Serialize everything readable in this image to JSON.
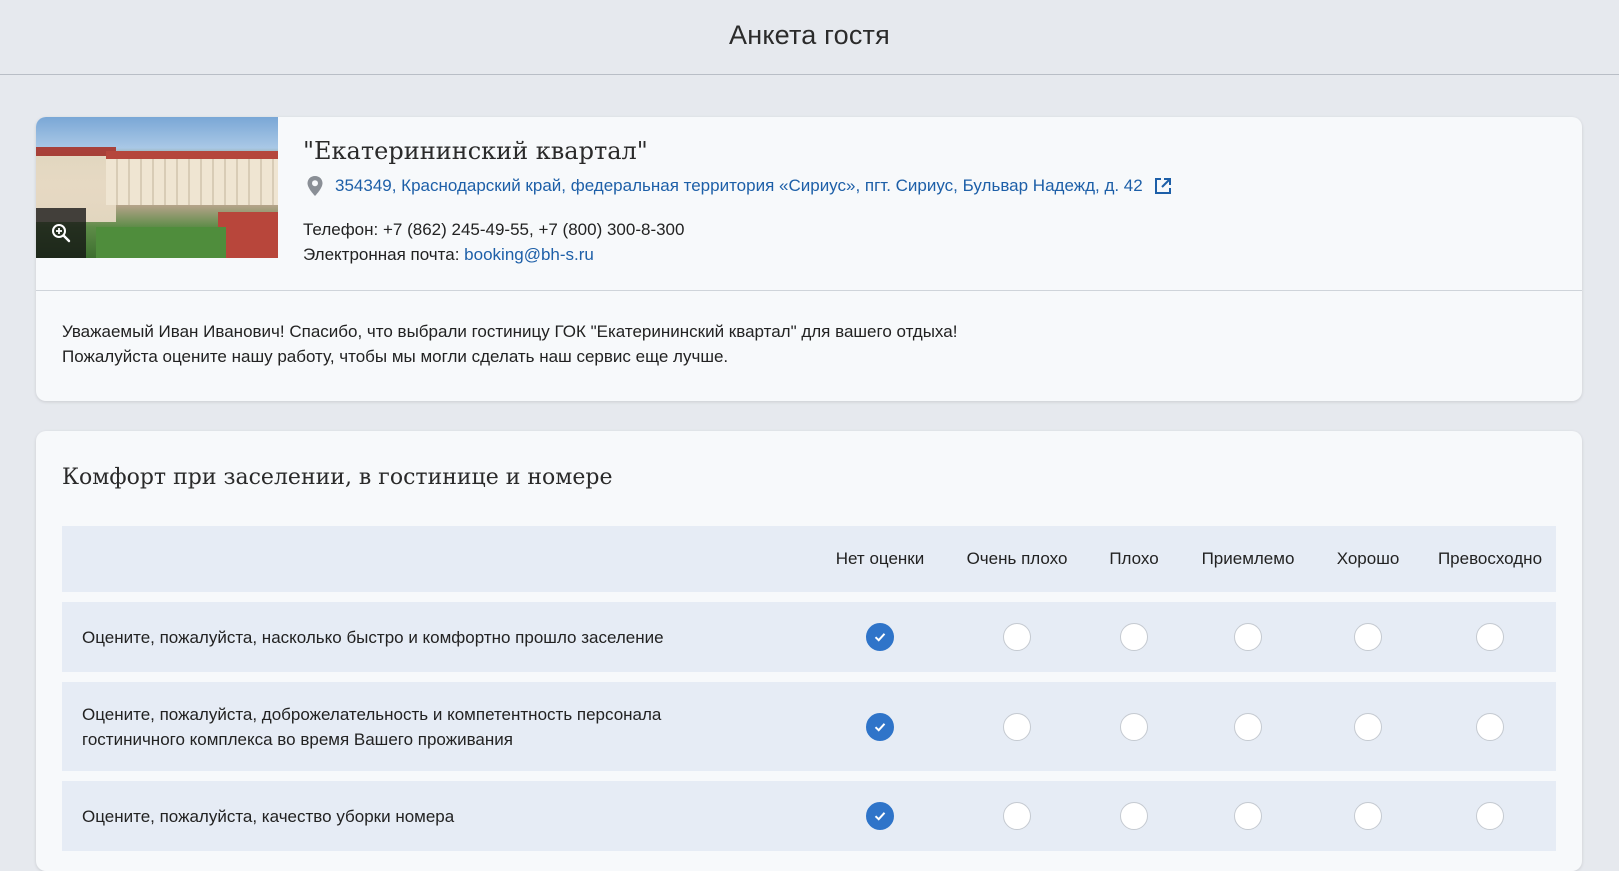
{
  "header": {
    "title": "Анкета гостя"
  },
  "hotel": {
    "name": "\"Екатерининский квартал\"",
    "address": "354349, Краснодарский край, федеральная территория «Сириус», пгт. Сириус, Бульвар Надежд, д. 42",
    "phone_label": "Телефон:",
    "phone_value": "+7 (862) 245-49-55, +7 (800) 300-8-300",
    "email_label": "Электронная почта:",
    "email_value": "booking@bh-s.ru",
    "icons": {
      "zoom": "zoom-in-icon",
      "location": "map-pin-icon",
      "external": "external-link-icon"
    }
  },
  "welcome": {
    "line1": "Уважаемый Иван Иванович! Спасибо, что выбрали гостиницу ГОК \"Екатерининский квартал\" для вашего отдыха!",
    "line2": "Пожалуйста оцените нашу работу, чтобы мы могли сделать наш сервис еще лучше."
  },
  "section": {
    "title": "Комфорт при заселении, в гостинице и номере",
    "columns": [
      "Нет оценки",
      "Очень плохо",
      "Плохо",
      "Приемлемо",
      "Хорошо",
      "Превосходно"
    ],
    "questions": [
      {
        "text": "Оцените, пожалуйста, насколько быстро и комфортно прошло заселение",
        "selected": "Нет оценки"
      },
      {
        "text_line1": "Оцените, пожалуйста, доброжелательность и компетентность персонала",
        "text_line2": "гостиничного комплекса во время Вашего проживания",
        "selected": "Нет оценки"
      },
      {
        "text": "Оцените, пожалуйста, качество уборки номера",
        "selected": "Нет оценки"
      }
    ]
  },
  "colors": {
    "accent": "#2f74c9",
    "link": "#1d5fa8",
    "background": "#e6e9ee",
    "card": "#f7f9fb",
    "row": "#e6ecf5"
  }
}
